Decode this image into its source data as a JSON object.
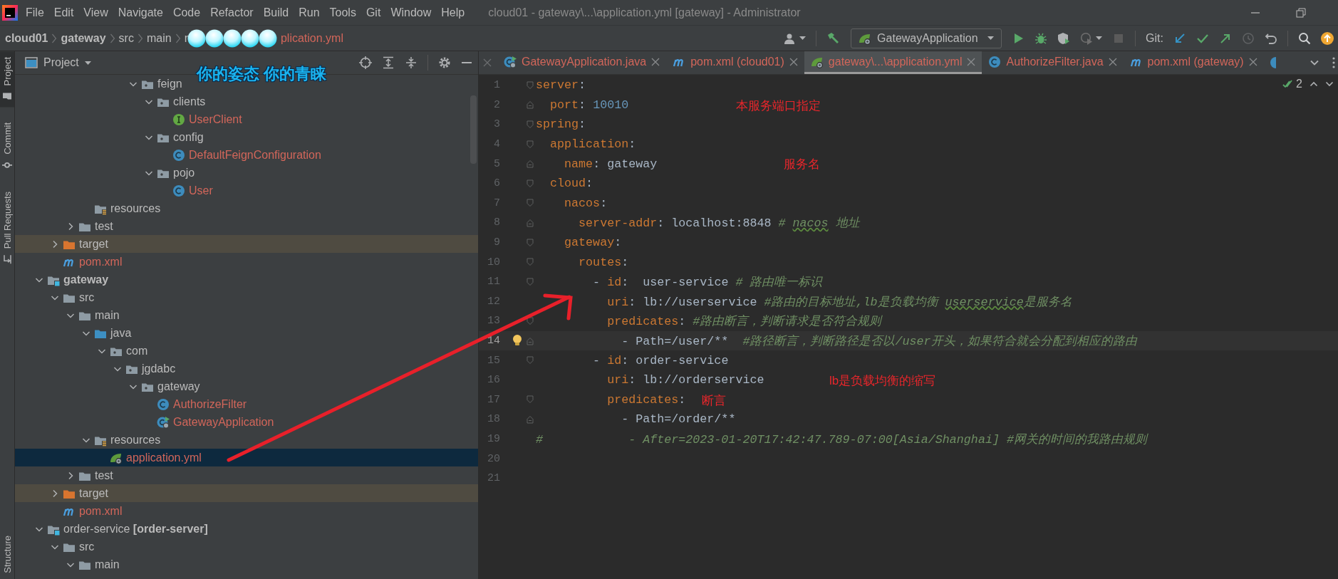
{
  "window": {
    "title": "cloud01 - gateway\\...\\application.yml [gateway] - Administrator"
  },
  "menu": [
    "File",
    "Edit",
    "View",
    "Navigate",
    "Code",
    "Refactor",
    "Build",
    "Run",
    "Tools",
    "Git",
    "Window",
    "Help"
  ],
  "breadcrumb": [
    {
      "label": "cloud01",
      "kind": "module"
    },
    {
      "label": "gateway",
      "kind": "module"
    },
    {
      "label": "src",
      "kind": "dir"
    },
    {
      "label": "main",
      "kind": "dir"
    },
    {
      "label": "r",
      "kind": "dir",
      "covered": true
    },
    {
      "label": "plication.yml",
      "kind": "file"
    }
  ],
  "toolbar": {
    "run_config": "GatewayApplication",
    "git_label": "Git:"
  },
  "side_strip": {
    "top": [
      {
        "label": "Project",
        "kind": "project",
        "selected": true
      },
      {
        "label": "Commit",
        "kind": "commit",
        "selected": false
      },
      {
        "label": "Pull Requests",
        "kind": "pull",
        "selected": false
      }
    ],
    "bottom": [
      {
        "label": "Structure",
        "selected": false
      }
    ]
  },
  "project": {
    "title": "Project",
    "tree": [
      {
        "children": [
          {
            "children": [
              {
                "children": [
                  {
                    "children": [
                      {
                        "children": [
                          {
                            "children": [
                              {
                                "label": "feign",
                                "kind": "package",
                                "expanded": true,
                                "selected": false,
                                "children": [
                                  {
                                    "label": "clients",
                                    "kind": "package",
                                    "expanded": true,
                                    "selected": false,
                                    "children": [
                                      {
                                        "label": "UserClient",
                                        "kind": "interface",
                                        "selected": false
                                      }
                                    ]
                                  },
                                  {
                                    "label": "config",
                                    "kind": "package",
                                    "expanded": true,
                                    "selected": false,
                                    "children": [
                                      {
                                        "label": "DefaultFeignConfiguration",
                                        "kind": "class",
                                        "selected": false
                                      }
                                    ]
                                  },
                                  {
                                    "label": "pojo",
                                    "kind": "package",
                                    "expanded": true,
                                    "selected": false,
                                    "children": [
                                      {
                                        "label": "User",
                                        "kind": "class",
                                        "selected": false
                                      }
                                    ]
                                  }
                                ]
                              }
                            ]
                          }
                        ]
                      }
                    ]
                  },
                  {
                    "label": "resources",
                    "kind": "resources",
                    "selected": false
                  }
                ]
              },
              {
                "label": "test",
                "kind": "folder",
                "expanded": false,
                "selected": false
              }
            ]
          },
          {
            "label": "target",
            "kind": "excluded",
            "expanded": false,
            "selected": false
          },
          {
            "label": "pom.xml",
            "kind": "maven",
            "selected": false
          }
        ]
      },
      {
        "label": "gateway",
        "kind": "module",
        "bold": true,
        "expanded": true,
        "selected": false,
        "children": [
          {
            "label": "src",
            "kind": "folder",
            "expanded": true,
            "selected": false,
            "children": [
              {
                "label": "main",
                "kind": "folder",
                "expanded": true,
                "selected": false,
                "children": [
                  {
                    "label": "java",
                    "kind": "source",
                    "expanded": true,
                    "selected": false,
                    "children": [
                      {
                        "label": "com",
                        "kind": "package",
                        "expanded": true,
                        "selected": false,
                        "children": [
                          {
                            "label": "jgdabc",
                            "kind": "package",
                            "expanded": true,
                            "selected": false,
                            "children": [
                              {
                                "label": "gateway",
                                "kind": "package",
                                "expanded": true,
                                "selected": false,
                                "children": [
                                  {
                                    "label": "AuthorizeFilter",
                                    "kind": "class",
                                    "selected": false
                                  },
                                  {
                                    "label": "GatewayApplication",
                                    "kind": "spring-class",
                                    "selected": false
                                  }
                                ]
                              }
                            ]
                          }
                        ]
                      }
                    ]
                  },
                  {
                    "label": "resources",
                    "kind": "resources",
                    "expanded": true,
                    "selected": false,
                    "children": [
                      {
                        "label": "application.yml",
                        "kind": "yaml",
                        "selected": true
                      }
                    ]
                  }
                ]
              },
              {
                "label": "test",
                "kind": "folder",
                "expanded": false,
                "selected": false
              }
            ]
          },
          {
            "label": "target",
            "kind": "excluded",
            "expanded": false,
            "selected": false
          },
          {
            "label": "pom.xml",
            "kind": "maven",
            "selected": false
          }
        ]
      },
      {
        "label": "order-service **[order-server]**",
        "kind": "module",
        "expanded": true,
        "selected": false,
        "children": [
          {
            "label": "src",
            "kind": "folder",
            "expanded": true,
            "selected": false,
            "children": [
              {
                "label": "main",
                "kind": "folder",
                "expanded": true,
                "selected": false
              }
            ]
          }
        ]
      }
    ]
  },
  "editor": {
    "tabs": [
      {
        "label": "GatewayApplication.java",
        "kind": "spring-class",
        "selected": false
      },
      {
        "label": "pom.xml (cloud01)",
        "kind": "maven",
        "selected": false
      },
      {
        "label": "gateway\\...\\application.yml",
        "kind": "yaml",
        "selected": true
      },
      {
        "label": "AuthorizeFilter.java",
        "kind": "class",
        "selected": false
      },
      {
        "label": "pom.xml (gateway)",
        "kind": "maven",
        "selected": false
      }
    ],
    "inspections": "2",
    "lines": [
      {
        "number": "1",
        "fold_start": true,
        "tokens": [
          {
            "kind": "key",
            "text": "server"
          },
          {
            "kind": "punct",
            "text": ":"
          }
        ]
      },
      {
        "number": "2",
        "fold_end": true,
        "tokens": [
          {
            "kind": "key",
            "text": "  port"
          },
          {
            "kind": "punct",
            "text": ": "
          },
          {
            "kind": "num",
            "text": "10010"
          }
        ],
        "note": "本服务端口指定"
      },
      {
        "number": "3",
        "fold_start": true,
        "tokens": [
          {
            "kind": "key",
            "text": "spring"
          },
          {
            "kind": "punct",
            "text": ":"
          }
        ]
      },
      {
        "number": "4",
        "fold_start": true,
        "tokens": [
          {
            "kind": "key",
            "text": "  application"
          },
          {
            "kind": "punct",
            "text": ":"
          }
        ]
      },
      {
        "number": "5",
        "fold_end": true,
        "tokens": [
          {
            "kind": "key",
            "text": "    name"
          },
          {
            "kind": "punct",
            "text": ": "
          },
          {
            "kind": "plain",
            "text": "gateway"
          }
        ],
        "note": "服务名"
      },
      {
        "number": "6",
        "fold_start": true,
        "tokens": [
          {
            "kind": "key",
            "text": "  cloud"
          },
          {
            "kind": "punct",
            "text": ":"
          }
        ]
      },
      {
        "number": "7",
        "fold_start": true,
        "tokens": [
          {
            "kind": "key",
            "text": "    nacos"
          },
          {
            "kind": "punct",
            "text": ":"
          }
        ]
      },
      {
        "number": "8",
        "fold_end": true,
        "tokens": [
          {
            "kind": "key",
            "text": "      server-addr"
          },
          {
            "kind": "punct",
            "text": ": "
          },
          {
            "kind": "plain",
            "text": "localhost:8848 "
          },
          {
            "kind": "comment",
            "text": "# "
          },
          {
            "kind": "typo",
            "text": "nacos"
          },
          {
            "kind": "comment",
            "text": " 地址"
          }
        ]
      },
      {
        "number": "9",
        "fold_start": true,
        "tokens": [
          {
            "kind": "key",
            "text": "    gateway"
          },
          {
            "kind": "punct",
            "text": ":"
          }
        ]
      },
      {
        "number": "10",
        "fold_start": true,
        "tokens": [
          {
            "kind": "key",
            "text": "      routes"
          },
          {
            "kind": "punct",
            "text": ":"
          }
        ]
      },
      {
        "number": "11",
        "fold_start": true,
        "tokens": [
          {
            "kind": "plain",
            "text": "        - "
          },
          {
            "kind": "key",
            "text": "id"
          },
          {
            "kind": "punct",
            "text": ":  "
          },
          {
            "kind": "plain",
            "text": "user-service "
          },
          {
            "kind": "comment",
            "text": "# 路由唯一标识"
          }
        ]
      },
      {
        "number": "12",
        "tokens": [
          {
            "kind": "key",
            "text": "          uri"
          },
          {
            "kind": "punct",
            "text": ": "
          },
          {
            "kind": "plain",
            "text": "lb://userservice "
          },
          {
            "kind": "comment",
            "text": "#路由的目标地址,lb是负载均衡 "
          },
          {
            "kind": "typo",
            "text": "userservice"
          },
          {
            "kind": "comment",
            "text": "是服务名"
          }
        ]
      },
      {
        "number": "13",
        "fold_start": true,
        "tokens": [
          {
            "kind": "key",
            "text": "          predicates"
          },
          {
            "kind": "punct",
            "text": ": "
          },
          {
            "kind": "comment",
            "text": "#路由断言，判断请求是否符合规则"
          }
        ]
      },
      {
        "number": "14",
        "fold_end": true,
        "current": true,
        "tokens": [
          {
            "kind": "plain",
            "text": "            - Path=/user/**  "
          },
          {
            "kind": "comment",
            "text": "#路径断言，判断路径是否以/user开头，如果符合就会分配到相应的路由"
          }
        ]
      },
      {
        "number": "15",
        "fold_start": true,
        "tokens": [
          {
            "kind": "plain",
            "text": "        - "
          },
          {
            "kind": "key",
            "text": "id"
          },
          {
            "kind": "punct",
            "text": ": "
          },
          {
            "kind": "plain",
            "text": "order-service"
          }
        ]
      },
      {
        "number": "16",
        "tokens": [
          {
            "kind": "key",
            "text": "          uri"
          },
          {
            "kind": "punct",
            "text": ": "
          },
          {
            "kind": "plain",
            "text": "lb://orderservice"
          }
        ],
        "note": "lb是负载均衡的缩写"
      },
      {
        "number": "17",
        "fold_start": true,
        "tokens": [
          {
            "kind": "key",
            "text": "          predicates"
          },
          {
            "kind": "punct",
            "text": ":"
          }
        ],
        "note": "断言"
      },
      {
        "number": "18",
        "fold_end": true,
        "tokens": [
          {
            "kind": "plain",
            "text": "            - Path=/order/**"
          }
        ]
      },
      {
        "number": "19",
        "tokens": [
          {
            "kind": "comment",
            "text": "#            - After=2023-01-20T17:42:47.789-07:00[Asia/Shanghai] #网关的时间的我路由规则"
          }
        ]
      },
      {
        "number": "20"
      },
      {
        "number": "21"
      }
    ]
  },
  "overlay": {
    "caption": "你的姿态 你的青睐"
  }
}
